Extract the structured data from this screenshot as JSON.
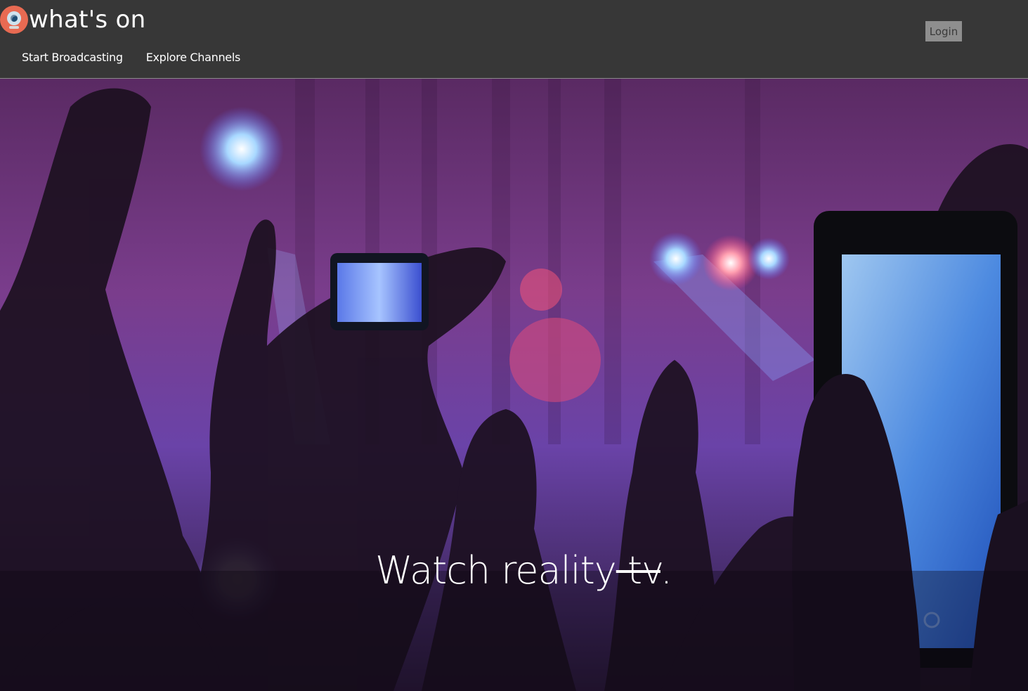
{
  "header": {
    "brand_name": "what's on",
    "logo_icon": "webcam-icon",
    "login_label": "Login",
    "nav": [
      {
        "label": "Start Broadcasting"
      },
      {
        "label": "Explore Channels"
      }
    ]
  },
  "hero": {
    "tagline_main": "Watch reality",
    "tagline_struck": " tv",
    "tagline_end": "."
  },
  "colors": {
    "header_bg": "#373737",
    "logo": "#e86a52",
    "login_bg": "#8e8e8e",
    "hero_tint": "#6a2c8a"
  }
}
